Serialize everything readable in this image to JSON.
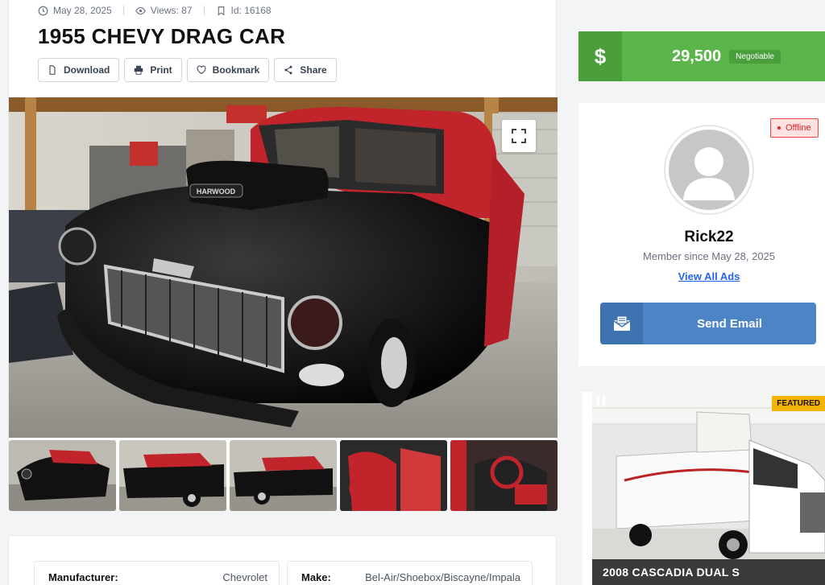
{
  "listing": {
    "date": "May 28, 2025",
    "views": "Views: 87",
    "id": "Id: 16168",
    "title": "1955 CHEVY DRAG CAR"
  },
  "actions": {
    "download": "Download",
    "print": "Print",
    "bookmark": "Bookmark",
    "share": "Share"
  },
  "specs": [
    {
      "key": "Manufacturer:",
      "value": "Chevrolet"
    },
    {
      "key": "Make:",
      "value": "Bel-Air/Shoebox/Biscayne/Impala"
    }
  ],
  "price": {
    "currency_symbol": "$",
    "amount": "29,500",
    "tag": "Negotiable"
  },
  "seller": {
    "status": "Offline",
    "name": "Rick22",
    "since": "Member since May 28, 2025",
    "view_all": "View All Ads",
    "send_email": "Send Email"
  },
  "featured": {
    "badge": "FEATURED",
    "title": "2008 CASCADIA DUAL S"
  },
  "photo_text": {
    "hood_scoop": "HARWOOD"
  },
  "colors": {
    "price_green": "#5bb54a",
    "email_blue": "#4d84c6",
    "offline_red": "#dc2626",
    "badge_yellow": "#f5b400"
  }
}
